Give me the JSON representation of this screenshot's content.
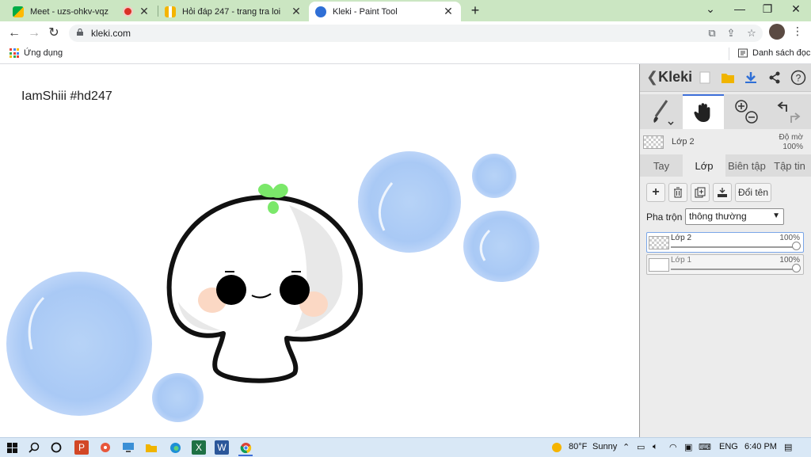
{
  "browser": {
    "tabs": [
      {
        "title": "Meet - uzs-ohkv-vqz",
        "favicon": "meet-icon",
        "recording": true
      },
      {
        "title": "Hỏi đáp 247 - trang tra loi",
        "favicon": "hoidap-icon"
      },
      {
        "title": "Kleki - Paint Tool",
        "favicon": "kleki-icon",
        "active": true
      }
    ],
    "new_tab": "+",
    "url": "kleki.com",
    "bookmarks": {
      "apps_label": "Ứng dụng",
      "reading_list_label": "Danh sách đọc"
    }
  },
  "canvas": {
    "text": "IamShiii #hd247"
  },
  "kleki": {
    "logo_text": "Kleki",
    "active_layer": {
      "name": "Lớp 2",
      "opacity_label": "Độ mờ",
      "opacity_value": "100%"
    },
    "tabs": [
      "Tay",
      "Lớp",
      "Biên tập",
      "Tập tin"
    ],
    "active_tab": "Lớp",
    "actions": {
      "rename_label": "Đổi tên"
    },
    "blend": {
      "label": "Pha trộn",
      "value": "thông thường"
    },
    "layers": [
      {
        "name": "Lớp 2",
        "opacity": "100%",
        "selected": true
      },
      {
        "name": "Lớp 1",
        "opacity": "100%",
        "selected": false
      }
    ]
  },
  "taskbar": {
    "weather": {
      "temp": "80°F",
      "condition": "Sunny"
    },
    "language": "ENG",
    "time": "6:40 PM"
  },
  "colors": {
    "tab_strip": "#cbe6c2",
    "bubble": "#a9c9f5",
    "sprout": "#7be86a",
    "cheek": "#fbd8c4",
    "accent": "#3c6ed8"
  }
}
